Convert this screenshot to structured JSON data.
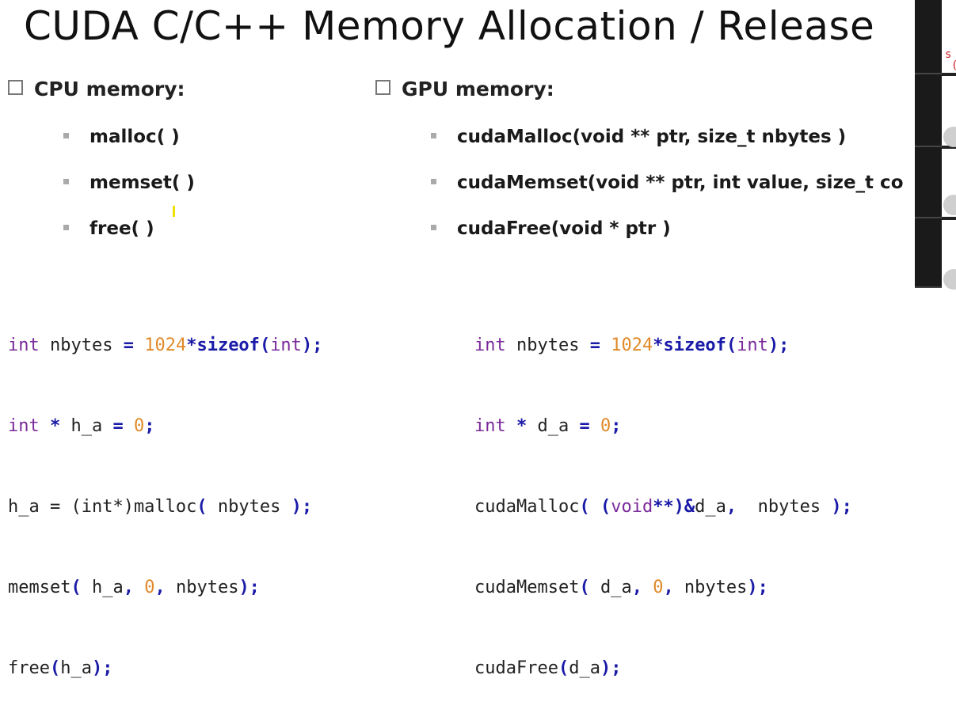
{
  "title": "CUDA C/C++ Memory Allocation / Release",
  "cpu": {
    "heading": "CPU memory:",
    "items": [
      "malloc( )",
      "memset( )",
      "free( )"
    ]
  },
  "gpu": {
    "heading": "GPU memory:",
    "items": [
      "cudaMalloc(void ** ptr, size_t nbytes )",
      "cudaMemset(void ** ptr, int value, size_t co",
      "cudaFree(void * ptr )"
    ]
  },
  "right_edge_text": [
    "s",
    "("
  ]
}
